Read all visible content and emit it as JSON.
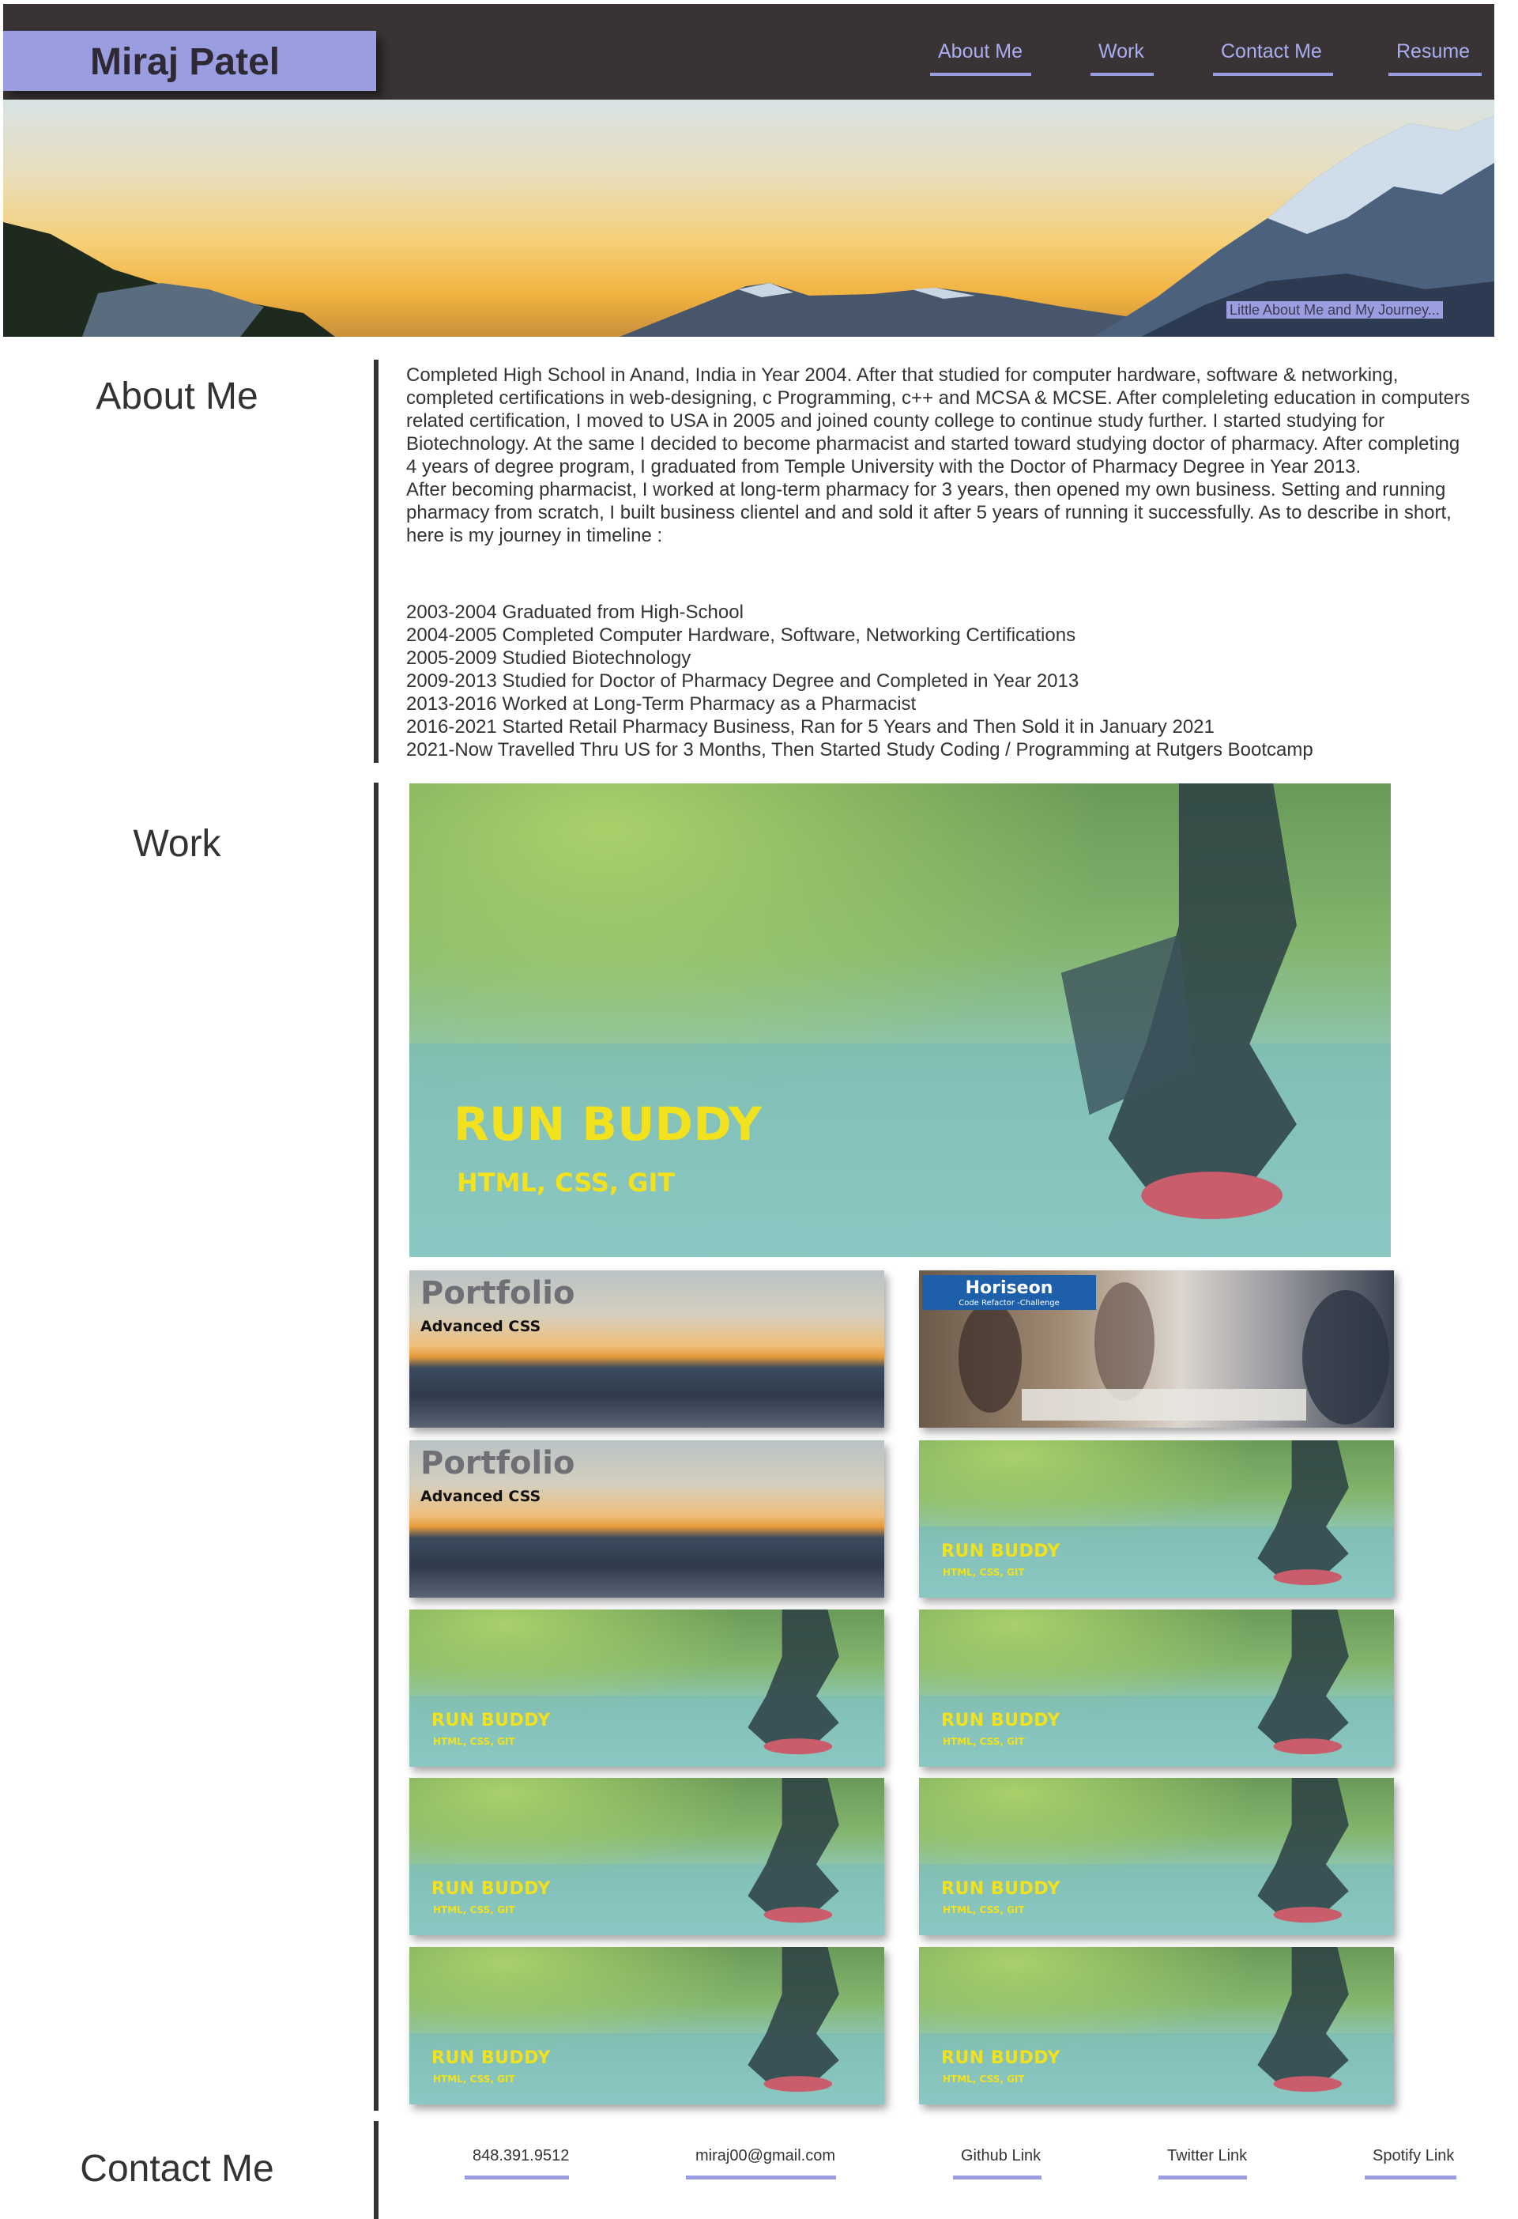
{
  "header": {
    "name": "Miraj Patel",
    "nav": [
      "About Me",
      "Work",
      "Contact Me",
      "Resume"
    ]
  },
  "hero": {
    "caption": "Little About Me and My Journey..."
  },
  "about": {
    "title": "About Me",
    "paragraph1": "Completed High School in Anand, India in Year 2004. After that studied for computer hardware, software & networking, completed certifications in web-designing, c Programming, c++ and MCSA & MCSE. After compleleting education in computers related certification, I moved to USA in 2005 and joined county college to continue study further. I started studying for Biotechnology. At the same I decided to become pharmacist and started toward studying doctor of pharmacy. After completing 4 years of degree program, I graduated from Temple University with the Doctor of Pharmacy Degree in Year 2013.",
    "paragraph2": "After becoming pharmacist, I worked at long-term pharmacy for 3 years, then opened my own business. Setting and running pharmacy from scratch, I built business clientel and and sold it after 5 years of running it successfully. As to describe in short, here is my journey in timeline :",
    "timeline": [
      "2003-2004 Graduated from High-School",
      "2004-2005 Completed Computer Hardware, Software, Networking Certifications",
      "2005-2009 Studied Biotechnology",
      "2009-2013 Studied for Doctor of Pharmacy Degree and Completed in Year 2013",
      "2013-2016 Worked at Long-Term Pharmacy as a Pharmacist",
      "2016-2021 Started Retail Pharmacy Business, Ran for 5 Years and Then Sold it in January 2021",
      "2021-Now Travelled Thru US for 3 Months, Then Started Study Coding / Programming at Rutgers Bootcamp"
    ]
  },
  "work": {
    "title": "Work",
    "featured": {
      "title": "RUN BUDDY",
      "tech": "HTML, CSS, GIT"
    },
    "portfolio": {
      "title": "Portfolio",
      "subtitle": "Advanced CSS"
    },
    "horiseon": {
      "title": "Horiseon",
      "subtitle": "Code Refactor -Challenge"
    },
    "runbuddy": {
      "title": "RUN BUDDY",
      "tech": "HTML, CSS, GIT"
    }
  },
  "contact": {
    "title": "Contact Me",
    "links": [
      "848.391.9512",
      "miraj00@gmail.com",
      "Github Link",
      "Twitter Link",
      "Spotify Link"
    ]
  },
  "colors": {
    "accent": "#9a9de0",
    "header_bg": "#3a3335",
    "project_title": "#f2e21d"
  }
}
